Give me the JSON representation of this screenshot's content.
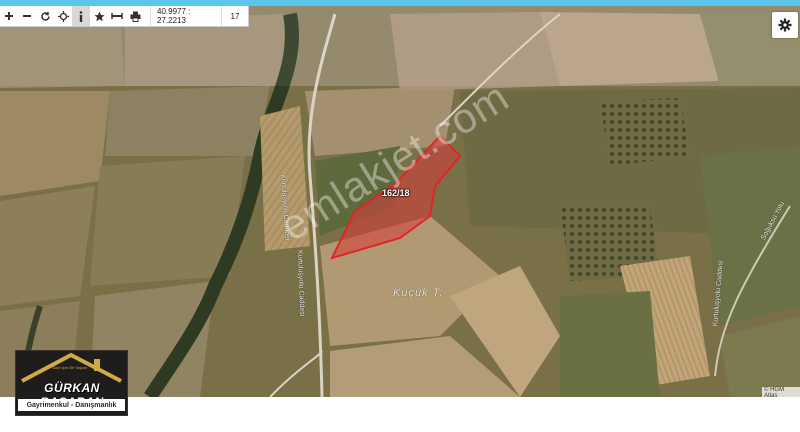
{
  "toolbar": {
    "zoom_in_icon": "plus-icon",
    "zoom_out_icon": "minus-icon",
    "refresh_icon": "refresh-icon",
    "locate_icon": "crosshair-icon",
    "info_icon": "info-icon",
    "favorite_icon": "star-icon",
    "measure_icon": "ruler-icon",
    "print_icon": "printer-icon",
    "coordinates": "40.9977 : 27.2213",
    "zoom_level": "17"
  },
  "settings": {
    "icon": "gear-icon"
  },
  "map": {
    "parcel_label": "162/18",
    "place_label": "Küçük T.",
    "road_labels": [
      "Kurtuluşyolu Caddesi",
      "Kurtuluşyolu Caddesi",
      "Kurtuluşyolu Caddesi",
      "Soğuksu Yolu"
    ],
    "attribution": "© HGM Atlas",
    "watermark": "emlakjet.com",
    "parcel_color": "#d93a3a"
  },
  "logo": {
    "tagline": "Sizin İçin Bir Yaşam",
    "name": "GÜRKAN BAŞARAN",
    "subtitle": "Gayrimenkul - Danışmanlık"
  }
}
